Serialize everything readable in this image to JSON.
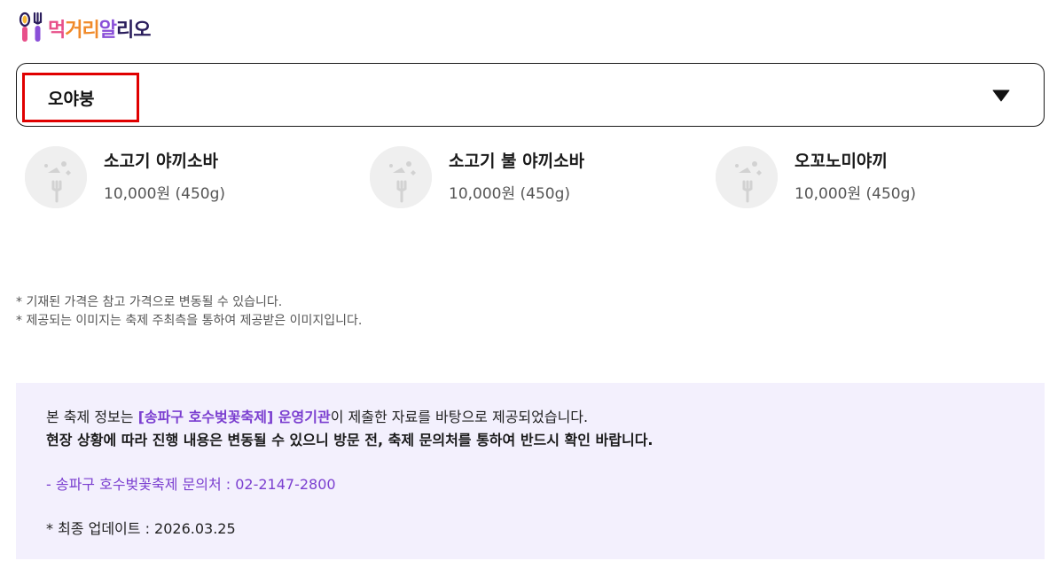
{
  "header": {
    "logo_parts": [
      "먹",
      "거리",
      " 알",
      "리오"
    ]
  },
  "dropdown": {
    "selected": "오야붕"
  },
  "menu": [
    {
      "name": "소고기 야끼소바",
      "price": "10,000원 (450g)"
    },
    {
      "name": "소고기 불 야끼소바",
      "price": "10,000원 (450g)"
    },
    {
      "name": "오꼬노미야끼",
      "price": "10,000원 (450g)"
    }
  ],
  "notes": [
    "* 기재된 가격은 참고 가격으로 변동될 수 있습니다.",
    "* 제공되는 이미지는 축제 주최측을 통하여 제공받은 이미지입니다."
  ],
  "info": {
    "line1_prefix": "본 축제 정보는 ",
    "line1_highlight": "[송파구 호수벚꽃축제] 운영기관",
    "line1_suffix": "이 제출한 자료를 바탕으로 제공되었습니다.",
    "line2": "현장 상황에 따라 진행 내용은 변동될 수 있으니 방문 전, 축제 문의처를 통하여 반드시 확인 바랍니다.",
    "contact": "- 송파구 호수벚꽃축제 문의처 : 02-2147-2800",
    "updated": "* 최종 업데이트 : 2026.03.25"
  },
  "colors": {
    "accent": "#7b3fd0",
    "highlight_border": "#e00000",
    "info_bg": "#f3f0fd"
  },
  "icons": {
    "logo": "fork-spoon-icon",
    "caret": "caret-down-icon",
    "thumb": "food-placeholder-icon"
  }
}
